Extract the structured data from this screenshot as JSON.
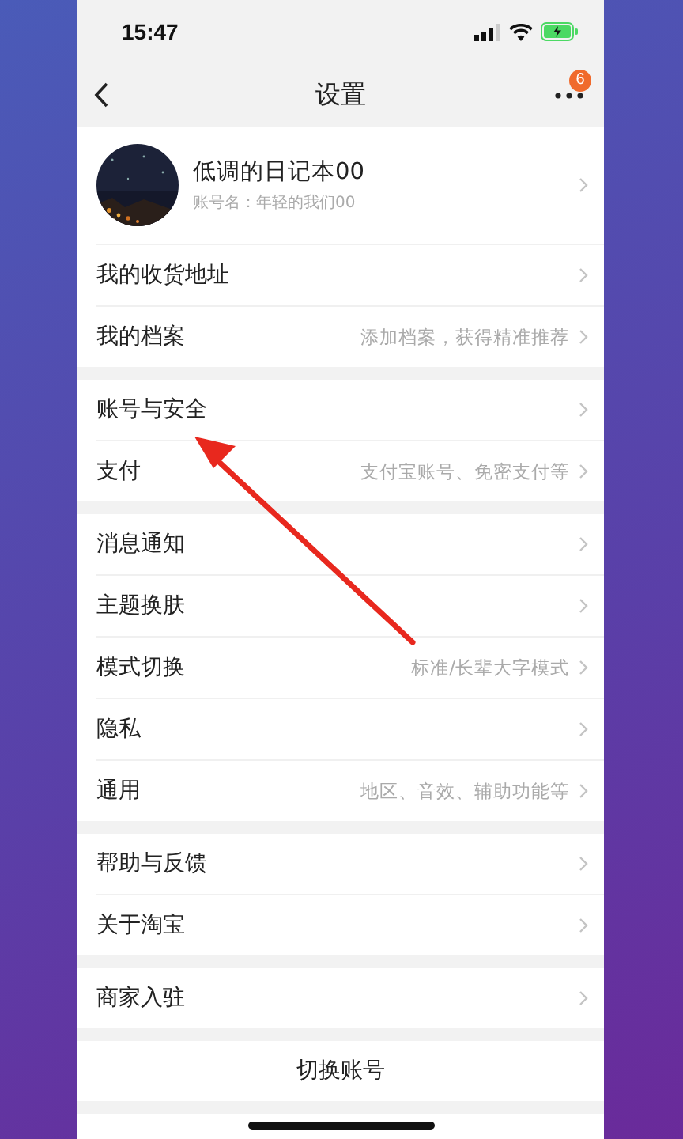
{
  "status_bar": {
    "time": "15:47"
  },
  "nav": {
    "title": "设置",
    "badge": "6"
  },
  "profile": {
    "name": "低调的日记本00",
    "account": "账号名：年轻的我们00"
  },
  "groups": [
    {
      "items": [
        {
          "label": "我的收货地址"
        },
        {
          "label": "我的档案",
          "detail": "添加档案，获得精准推荐"
        }
      ]
    },
    {
      "items": [
        {
          "label": "账号与安全"
        },
        {
          "label": "支付",
          "detail": "支付宝账号、免密支付等"
        }
      ]
    },
    {
      "items": [
        {
          "label": "消息通知"
        },
        {
          "label": "主题换肤"
        },
        {
          "label": "模式切换",
          "detail": "标准/长辈大字模式"
        },
        {
          "label": "隐私"
        },
        {
          "label": "通用",
          "detail": "地区、音效、辅助功能等"
        }
      ]
    },
    {
      "items": [
        {
          "label": "帮助与反馈"
        },
        {
          "label": "关于淘宝"
        }
      ]
    },
    {
      "items": [
        {
          "label": "商家入驻"
        }
      ]
    }
  ],
  "buttons": [
    "切换账号"
  ]
}
